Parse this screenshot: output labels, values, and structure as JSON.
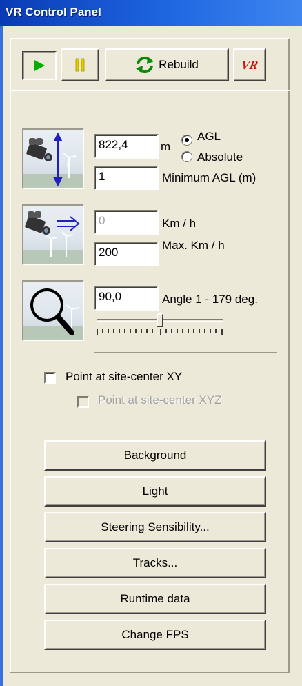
{
  "window": {
    "title": "VR Control Panel"
  },
  "toolbar": {
    "play_icon": "play-icon",
    "pause_icon": "pause-icon",
    "rebuild_label": "Rebuild",
    "rebuild_icon": "refresh-icon",
    "vr_logo_text": "VR"
  },
  "camera": {
    "height_value": "822,4",
    "height_unit": "m",
    "agl_label": "AGL",
    "absolute_label": "Absolute",
    "altitude_mode": "AGL",
    "min_agl_value": "1",
    "min_agl_label": "Minimum AGL (m)"
  },
  "speed": {
    "current_value": "0",
    "current_label": "Km / h",
    "max_value": "200",
    "max_label": "Max. Km / h"
  },
  "zoom": {
    "angle_value": "90,0",
    "angle_label": "Angle 1 - 179 deg.",
    "slider_value": 90,
    "slider_min": 1,
    "slider_max": 179
  },
  "options": {
    "point_xy_label": "Point at site-center XY",
    "point_xy_checked": false,
    "point_xyz_label": "Point at site-center XYZ",
    "point_xyz_checked": false,
    "point_xyz_enabled": false
  },
  "buttons": {
    "background": "Background",
    "light": "Light",
    "steering": "Steering Sensibility...",
    "tracks": "Tracks...",
    "runtime": "Runtime data",
    "fps": "Change FPS"
  },
  "colors": {
    "title_bar": "#0A3AB5",
    "face": "#ECE9D8",
    "play_green": "#00B000",
    "pause_yellow": "#E8D000",
    "vr_red": "#D01010",
    "arrow_blue": "#2020C0"
  }
}
